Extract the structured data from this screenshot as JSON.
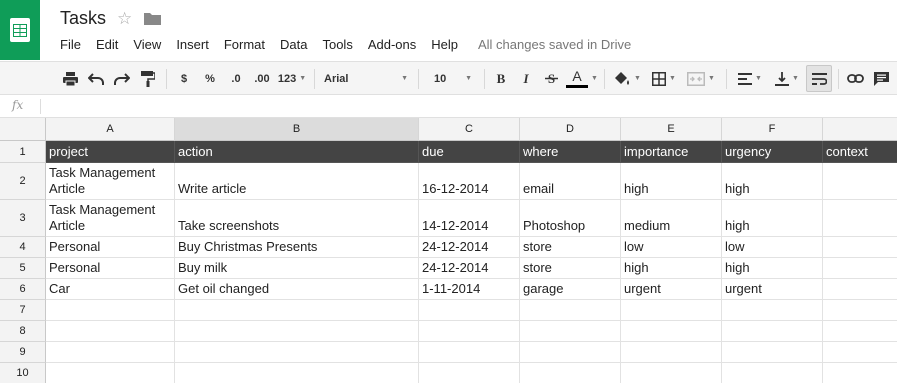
{
  "app": {
    "title": "Tasks",
    "save_status": "All changes saved in Drive"
  },
  "menu": [
    "File",
    "Edit",
    "View",
    "Insert",
    "Format",
    "Data",
    "Tools",
    "Add-ons",
    "Help"
  ],
  "toolbar": {
    "currency": "$",
    "percent": "%",
    "decrease_decimals": ".0",
    "increase_decimals": ".00",
    "more_formats": "123",
    "font_name": "Arial",
    "font_size": "10",
    "bold": "B",
    "italic": "I",
    "text_color_letter": "A"
  },
  "formula_bar": {
    "label": "fx",
    "value": ""
  },
  "sheet": {
    "columns": [
      "A",
      "B",
      "C",
      "D",
      "E",
      "F",
      ""
    ],
    "rows": [
      "1",
      "2",
      "3",
      "4",
      "5",
      "6",
      "7",
      "8",
      "9",
      "10"
    ],
    "cells": [
      [
        "project",
        "action",
        "due",
        "where",
        "importance",
        "urgency",
        "context"
      ],
      [
        "Task Management Article",
        "Write article",
        "16-12-2014",
        "email",
        "high",
        "high",
        ""
      ],
      [
        "Task Management Article",
        "Take screenshots",
        "14-12-2014",
        "Photoshop",
        "medium",
        "high",
        ""
      ],
      [
        "Personal",
        "Buy Christmas Presents",
        "24-12-2014",
        "store",
        "low",
        "low",
        ""
      ],
      [
        "Personal",
        "Buy milk",
        "24-12-2014",
        "store",
        "high",
        "high",
        ""
      ],
      [
        "Car",
        "Get oil changed",
        "1-11-2014",
        "garage",
        "urgent",
        "urgent",
        ""
      ],
      [
        "",
        "",
        "",
        "",
        "",
        "",
        ""
      ],
      [
        "",
        "",
        "",
        "",
        "",
        "",
        ""
      ],
      [
        "",
        "",
        "",
        "",
        "",
        "",
        ""
      ],
      [
        "",
        "",
        "",
        "",
        "",
        "",
        ""
      ]
    ]
  },
  "colors": {
    "brand": "#0f9d58",
    "header_row_bg": "#444444",
    "selected_column": "#dcdcdc"
  }
}
